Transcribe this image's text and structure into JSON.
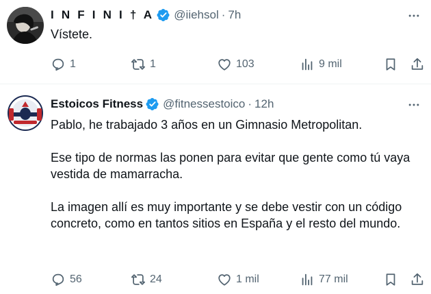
{
  "tweets": [
    {
      "name": "I N F I N I † A",
      "handle": "@iiehsol",
      "separator": "·",
      "time": "7h",
      "text": "Vístete.",
      "replies": "1",
      "retweets": "1",
      "likes": "103",
      "views": "9 mil"
    },
    {
      "name": "Estoicos Fitness",
      "handle": "@fitnessestoico",
      "separator": "·",
      "time": "12h",
      "text": "Pablo, he trabajado 3 años en un Gimnasio Metropolitan.\n\nEse tipo de normas las ponen para evitar que gente como tú vaya vestida de mamarracha.\n\nLa imagen allí es muy importante y se debe vestir con un código concreto, como en tantos sitios en España y el resto del mundo.",
      "replies": "56",
      "retweets": "24",
      "likes": "1 mil",
      "views": "77 mil"
    }
  ],
  "colors": {
    "text": "#0f1419",
    "secondary": "#536471",
    "verified": "#1d9bf0",
    "divider": "#eff3f4"
  },
  "icons": [
    "verified-badge-icon",
    "more-icon",
    "reply-icon",
    "retweet-icon",
    "like-icon",
    "views-icon",
    "bookmark-icon",
    "share-icon"
  ]
}
